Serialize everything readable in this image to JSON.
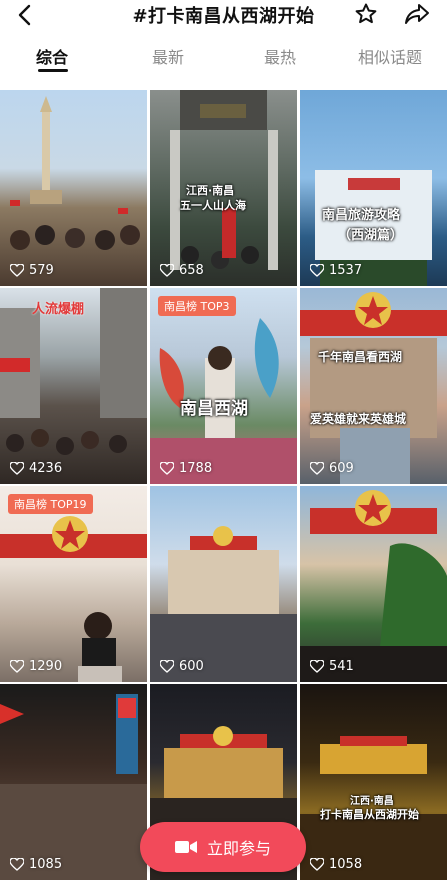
{
  "header": {
    "title": "#打卡南昌从西湖开始"
  },
  "tabs": [
    {
      "label": "综合",
      "active": true
    },
    {
      "label": "最新",
      "active": false
    },
    {
      "label": "最热",
      "active": false
    },
    {
      "label": "相似话题",
      "active": false
    }
  ],
  "posts": [
    {
      "likes": "579"
    },
    {
      "likes": "658",
      "overlay_line1": "江西·南昌",
      "overlay_line2": "五一人山人海"
    },
    {
      "likes": "1537",
      "overlay_line1": "南昌旅游攻略",
      "overlay_line2": "（西湖篇）"
    },
    {
      "likes": "4236",
      "overlay_line1": "人流爆棚"
    },
    {
      "likes": "1788",
      "badge": "南昌榜 TOP3",
      "overlay_line1": "南昌西湖"
    },
    {
      "likes": "609",
      "overlay_line1": "千年南昌看西湖",
      "overlay_line2": "爱英雄就来英雄城"
    },
    {
      "likes": "1290",
      "badge": "南昌榜 TOP19"
    },
    {
      "likes": "600"
    },
    {
      "likes": "541"
    },
    {
      "likes": "1085"
    },
    {
      "likes": ""
    },
    {
      "likes": "1058",
      "overlay_line1": "江西·南昌",
      "overlay_line2": "打卡南昌从西湖开始"
    }
  ],
  "join_button": {
    "label": "立即参与"
  },
  "colors": {
    "accent": "#f24a5a",
    "badge": "#f06b53"
  }
}
